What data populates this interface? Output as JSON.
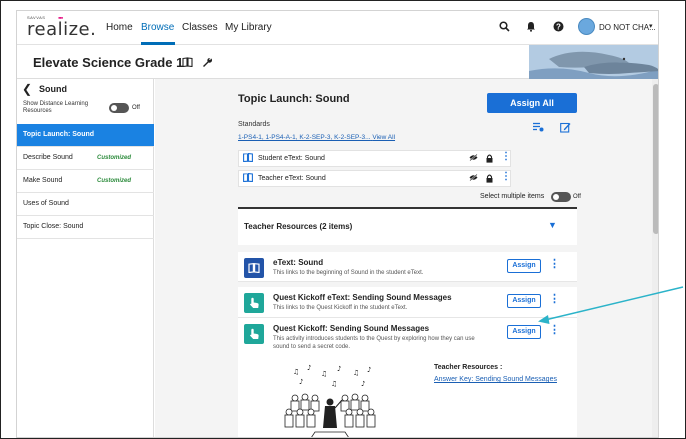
{
  "brand": {
    "top": "SAVVAS",
    "name": "realize."
  },
  "nav": {
    "home": "Home",
    "browse": "Browse",
    "classes": "Classes",
    "library": "My Library"
  },
  "user": {
    "name": "DO NOT CHA..."
  },
  "grade": {
    "title": "Elevate Science Grade 1"
  },
  "sidebar": {
    "title": "Sound",
    "toggle_label": "Show Distance Learning Resources",
    "toggle_state": "Off",
    "items": [
      {
        "label": "Topic Launch: Sound",
        "badge": ""
      },
      {
        "label": "Describe Sound",
        "badge": "Customized"
      },
      {
        "label": "Make Sound",
        "badge": "Customized"
      },
      {
        "label": "Uses of Sound",
        "badge": ""
      },
      {
        "label": "Topic Close: Sound",
        "badge": ""
      }
    ]
  },
  "main": {
    "title": "Topic Launch: Sound",
    "assign_all": "Assign All",
    "standards_label": "Standards",
    "standards": "1-PS4-1, 1-PS4-A-1, K-2-SEP-3, K-2-SEP-3...",
    "view_all": "View All",
    "etexts": [
      {
        "label": "Student eText: Sound"
      },
      {
        "label": "Teacher eText: Sound"
      }
    ],
    "multi_select_label": "Select multiple items",
    "multi_select_state": "Off",
    "resources_header": "Teacher Resources (2 items)",
    "cards": [
      {
        "title": "eText: Sound",
        "desc": "This links to the beginning of Sound in the student eText.",
        "assign": "Assign",
        "color": "#2354a8"
      },
      {
        "title": "Quest Kickoff eText: Sending Sound Messages",
        "desc": "This links to the Quest Kickoff in the student eText.",
        "assign": "Assign",
        "color": "#1fa79a"
      },
      {
        "title": "Quest Kickoff: Sending Sound Messages",
        "desc": "This activity introduces students to the Quest by exploring how they can use sound to send a secret code.",
        "assign": "Assign",
        "color": "#1fa79a"
      }
    ],
    "teacher_resources_label": "Teacher Resources :",
    "answer_key": "Answer Key: Sending Sound Messages"
  },
  "colors": {
    "accent": "#1a6fd6",
    "active_item": "#1a82e2",
    "customized": "#2a8a3a",
    "annotation_arrow": "#2bb3c9"
  }
}
